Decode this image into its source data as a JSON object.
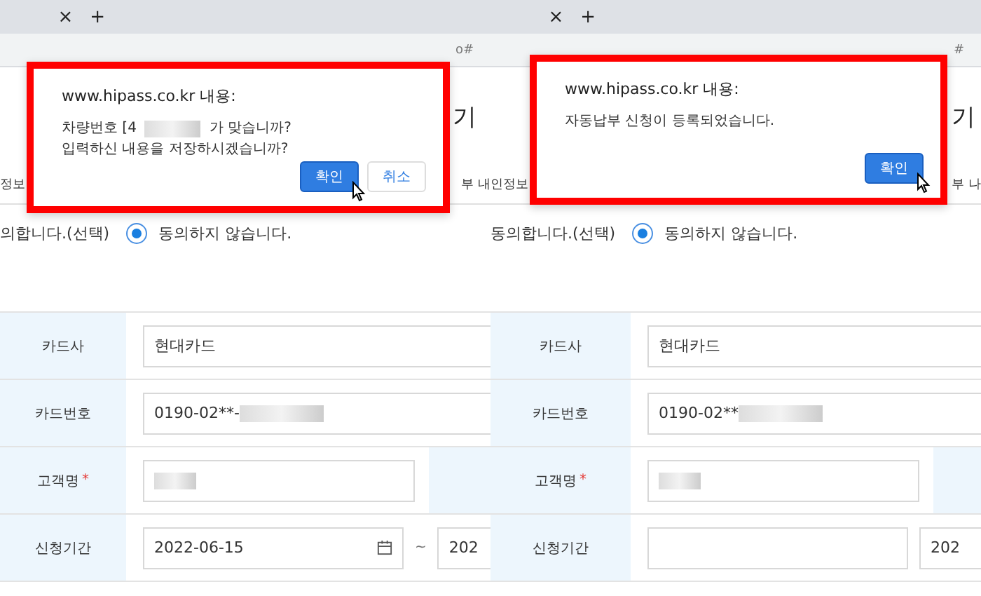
{
  "panels": [
    {
      "tab_close": "×",
      "tab_new": "+",
      "address_fragment": "o#",
      "heading_fragment": "기",
      "notice_left": "정보",
      "notice_right": "부 내",
      "agree_fragment": "의합니다.(선택)",
      "options": [
        {
          "label": "동의하지 않습니다.",
          "selected": true
        }
      ],
      "form": [
        {
          "kind": "text",
          "label": "카드사",
          "value": "현대카드",
          "redacted": false
        },
        {
          "kind": "text",
          "label": "카드번호",
          "value": "0190-02**-",
          "redacted": true
        },
        {
          "kind": "name",
          "label": "고객명",
          "required_mark": "*",
          "redacted": true
        },
        {
          "kind": "date",
          "label": "신청기간",
          "value": "2022-06-15",
          "separator": "~",
          "end_fragment": "202"
        }
      ],
      "dialog": {
        "origin": "www.hipass.co.kr 내용:",
        "lines": [
          {
            "before": "차량번호  [4",
            "redacted": true,
            "after": "가 맞습니까?"
          },
          {
            "before": "입력하신 내용을 저장하시겠습니까?",
            "redacted": false
          }
        ],
        "buttons": [
          {
            "label": "확인",
            "kind": "primary"
          },
          {
            "label": "취소",
            "kind": "secondary"
          }
        ]
      }
    },
    {
      "tab_close": "×",
      "tab_new": "+",
      "address_fragment": "#",
      "heading_fragment": "기",
      "notice_left": "인정보",
      "notice_right": "부 나",
      "agree_fragment": "동의합니다.(선택)",
      "options": [
        {
          "label": "동의하지 않습니다.",
          "selected": true
        }
      ],
      "form": [
        {
          "kind": "text",
          "label": "카드사",
          "value": "현대카드",
          "redacted": false
        },
        {
          "kind": "text",
          "label": "카드번호",
          "value": "0190-02**",
          "redacted": true
        },
        {
          "kind": "name",
          "label": "고객명",
          "required_mark": "*",
          "redacted": true
        },
        {
          "kind": "date",
          "label": "신청기간",
          "end_fragment": "202"
        }
      ],
      "dialog": {
        "origin": "www.hipass.co.kr 내용:",
        "lines": [
          {
            "before": "자동납부 신청이 등록되었습니다.",
            "redacted": false
          }
        ],
        "buttons": [
          {
            "label": "확인",
            "kind": "primary"
          }
        ]
      }
    }
  ]
}
